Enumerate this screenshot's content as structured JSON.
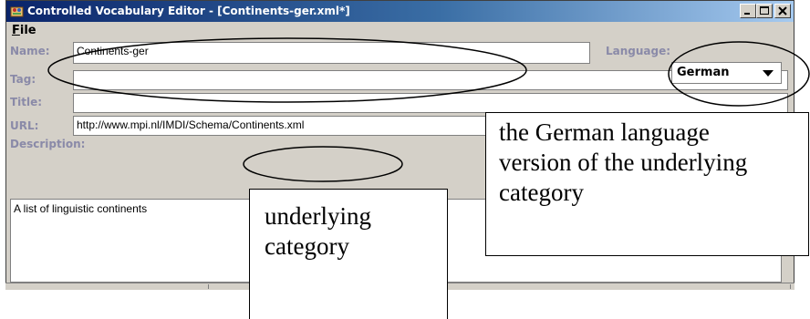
{
  "window": {
    "title": "Controlled Vocabulary Editor - [Continents-ger.xml*]",
    "controls": {
      "minimize": "minimize-icon",
      "maximize": "maximize-icon",
      "close": "close-icon"
    }
  },
  "menu": {
    "items": [
      {
        "label": "File",
        "mnemonic": "F"
      }
    ]
  },
  "form": {
    "name_label": "Name:",
    "name_value": "Continents-ger",
    "language_label": "Language:",
    "language_value": "German",
    "tag_label": "Tag:",
    "tag_value": "",
    "title_label": "Title:",
    "title_value": "",
    "url_label": "URL:",
    "url_value": "http://www.mpi.nl/IMDI/Schema/Continents.xml",
    "description_label": "Description:",
    "description_value": "A list of linguistic continents"
  },
  "annotations": {
    "german_note": [
      "the German language",
      "version of the underlying",
      "category"
    ],
    "underlying_note": [
      "underlying",
      "category"
    ]
  },
  "colors": {
    "label": "#8a8aa8",
    "titlebar_start": "#0a246a",
    "titlebar_end": "#a6caf0",
    "window_bg": "#d4d0c8"
  }
}
